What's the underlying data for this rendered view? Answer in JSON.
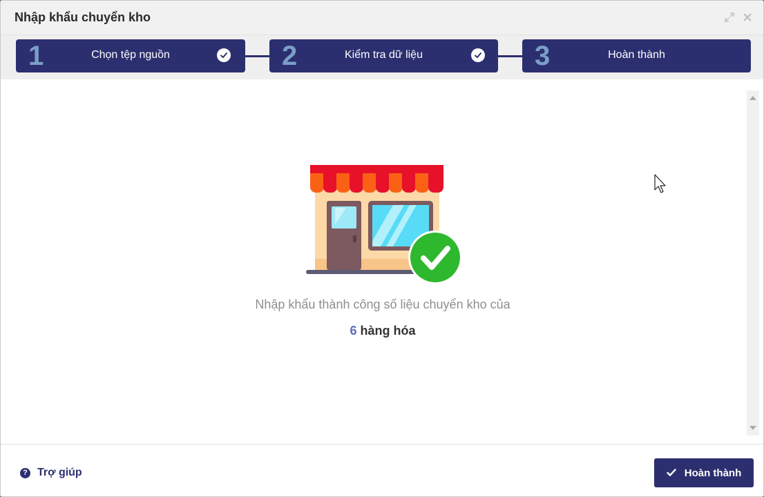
{
  "dialog": {
    "title": "Nhập khẩu chuyển kho"
  },
  "steps": [
    {
      "number": "1",
      "label": "Chọn tệp nguồn",
      "completed": true
    },
    {
      "number": "2",
      "label": "Kiểm tra dữ liệu",
      "completed": true
    },
    {
      "number": "3",
      "label": "Hoàn thành",
      "completed": false
    }
  ],
  "result": {
    "message": "Nhập khẩu thành công số liệu chuyển kho của",
    "count": "6",
    "unit": "hàng hóa"
  },
  "footer": {
    "help_icon": "?",
    "help_label": "Trợ giúp",
    "finish_label": "Hoàn thành"
  },
  "colors": {
    "primary": "#2c2f6f",
    "step_number": "#7a9fc7",
    "success": "#2eb82e",
    "count_accent": "#5b6bbf"
  },
  "icons": {
    "expand": "expand-icon",
    "close": "close-icon",
    "step_check": "check-circle-icon",
    "illustration": "store-success-illustration",
    "help": "help-circle-icon",
    "finish": "check-icon"
  }
}
